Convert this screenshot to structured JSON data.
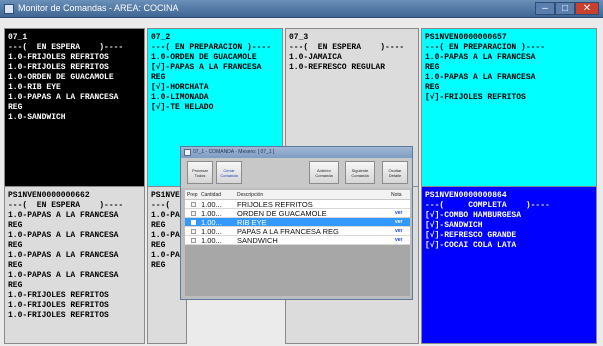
{
  "window": {
    "title": "Monitor de Comandas - AREA: COCINA",
    "min_glyph": "–",
    "max_glyph": "□",
    "close_glyph": "✕"
  },
  "panels": [
    {
      "text": "07_1\n---(  EN ESPERA    )----\n1.0-FRIJOLES REFRITOS\n1.0-FRIJOLES REFRITOS\n1.0-ORDEN DE GUACAMOLE\n1.0-RIB EYE\n1.0-PAPAS A LA FRANCESA\nREG\n1.0-SANDWICH",
      "color": "#000000"
    },
    {
      "text": "07_2\n---( EN PREPARACION )----\n1.0-ORDEN DE GUACAMOLE\n[√]-PAPAS A LA FRANCESA\nREG\n[√]-HORCHATA\n1.0-LIMONADA\n[√]-TE HELADO",
      "color": "#00ffff"
    },
    {
      "text": "07_3\n---(  EN ESPERA    )----\n1.0-JAMAICA\n1.0-REFRESCO REGULAR",
      "color": "#dcdcdc"
    },
    {
      "text": "PS1NVEN0000000657\n---( EN PREPARACION )----\n1.0-PAPAS A LA FRANCESA\nREG\n1.0-PAPAS A LA FRANCESA\nREG\n[√]-FRIJOLES REFRITOS",
      "color": "#00ffff"
    },
    {
      "text": "PS1NVEN0000000662\n---(  EN ESPERA    )----\n1.0-PAPAS A LA FRANCESA\nREG\n1.0-PAPAS A LA FRANCESA\nREG\n1.0-PAPAS A LA FRANCESA\nREG\n1.0-PAPAS A LA FRANCESA\nREG\n1.0-FRIJOLES REFRITOS\n1.0-FRIJOLES REFRITOS\n1.0-FRIJOLES REFRITOS",
      "color": "#dcdcdc"
    },
    {
      "text": "PS1NVE\n---(\n1.0-PA\nREG\n1.0-PA\nREG\n1.0-PA\nREG",
      "color": "#dcdcdc"
    },
    {
      "text": "",
      "color": "#dcdcdc"
    },
    {
      "text": "PS1NVEN0000000864\n---(     COMPLETA    )----\n[√]-COMBO HAMBURGESA\n[√]-SANDWICH\n[√]-REFRESCO GRANDE\n[√]-COCAI COLA LATA",
      "color": "#0000ff"
    }
  ],
  "dialog": {
    "title": "07_1 - COMANDA - Mesero: [ 07_1 ]",
    "buttons": {
      "procesar": "Procesar\nTodos",
      "cerrar": "Cerrar\nComanda",
      "anterior": "Anterior\nComanda",
      "siguiente": "Siguiente\nComanda",
      "ocultar": "Ocultar\nDetalle"
    },
    "columns": {
      "prep": "Prep",
      "cantidad": "Cantidad",
      "descripcion": "Descripción",
      "nota": "Nota"
    },
    "rows": [
      {
        "qty": "1.00...",
        "desc": "FRIJOLES REFRITOS",
        "note": ""
      },
      {
        "qty": "1.00...",
        "desc": "ORDEN DE GUACAMOLE",
        "note": "ver"
      },
      {
        "qty": "1.00...",
        "desc": "RIB EYE",
        "note": "ver"
      },
      {
        "qty": "1.00...",
        "desc": "PAPAS A LA FRANCESA REG",
        "note": "ver"
      },
      {
        "qty": "1.00...",
        "desc": "SANDWICH",
        "note": "ver"
      }
    ],
    "selected_row": 2
  }
}
